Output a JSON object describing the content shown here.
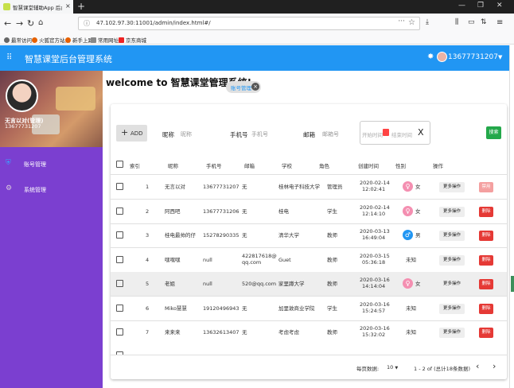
{
  "browser": {
    "tab_title": "智慧课堂辅助App 后台管理系统",
    "url": "47.102.97.30:11001/admin/index.html#/",
    "bookmarks": [
      "最常访问",
      "火狐官方站点",
      "新手上路",
      "常用网址",
      "京东商城"
    ]
  },
  "header": {
    "title": "智慧课堂后台管理系统",
    "user_phone": "13677731207"
  },
  "sidebar": {
    "user_name": "无言以对(管理)",
    "user_phone": "13677731207",
    "items": [
      {
        "label": "账号管理",
        "icon": "shield-icon"
      },
      {
        "label": "系统管理",
        "icon": "gear-icon"
      }
    ]
  },
  "main": {
    "welcome": "welcome to 智慧课堂管理系统!",
    "chip_label": "账号管理"
  },
  "toolbar": {
    "add_label": "ADD",
    "nickname_label": "昵称",
    "nickname_placeholder": "昵称",
    "phone_label": "手机号",
    "phone_placeholder": "手机号",
    "email_label": "邮箱",
    "email_placeholder": "邮箱号",
    "start_time_placeholder": "开始时间",
    "end_time_placeholder": "结束时间",
    "clear_label": "X",
    "search_label": "搜索"
  },
  "table": {
    "headers": [
      "索引",
      "昵称",
      "手机号",
      "邮箱",
      "学校",
      "角色",
      "创建时间",
      "性别",
      "操作"
    ],
    "more_label": "更多操作",
    "disable_label": "禁用",
    "delete_label": "删除",
    "rows": [
      {
        "index": "1",
        "nickname": "无言以对",
        "phone": "13677731207",
        "email": "无",
        "school": "桂林电子科技大学",
        "role": "管理员",
        "date": "2020-02-14",
        "time": "12:02:41",
        "gender": "女",
        "gender_type": "f",
        "action": "禁用"
      },
      {
        "index": "2",
        "nickname": "阿西吧",
        "phone": "13677731206",
        "email": "无",
        "school": "桂电",
        "role": "学生",
        "date": "2020-02-14",
        "time": "12:14:10",
        "gender": "女",
        "gender_type": "f",
        "action": "删除"
      },
      {
        "index": "3",
        "nickname": "桂电最帅的仔",
        "phone": "15278290335",
        "email": "无",
        "school": "清华大学",
        "role": "教师",
        "date": "2020-03-13",
        "time": "16:49:04",
        "gender": "男",
        "gender_type": "m",
        "action": "删除"
      },
      {
        "index": "4",
        "nickname": "嘿嘿嘿",
        "phone": "null",
        "email": "422817618@qq.com",
        "school": "Guet",
        "role": "教师",
        "date": "2020-03-15",
        "time": "05:36:18",
        "gender": "未知",
        "gender_type": "u",
        "action": "删除"
      },
      {
        "index": "5",
        "nickname": "老姐",
        "phone": "null",
        "email": "520@qq.com",
        "school": "家里蹲大学",
        "role": "教师",
        "date": "2020-03-16",
        "time": "14:14:04",
        "gender": "女",
        "gender_type": "f",
        "action": "删除"
      },
      {
        "index": "6",
        "nickname": "Miko慧慧",
        "phone": "19120496943",
        "email": "无",
        "school": "加里敦商业学院",
        "role": "学生",
        "date": "2020-03-16",
        "time": "15:24:57",
        "gender": "未知",
        "gender_type": "u",
        "action": "删除"
      },
      {
        "index": "7",
        "nickname": "来来来",
        "phone": "13632613407",
        "email": "无",
        "school": "考虑考虑",
        "role": "教师",
        "date": "2020-03-16",
        "time": "15:32:02",
        "gender": "未知",
        "gender_type": "u",
        "action": "删除"
      }
    ]
  },
  "pagination": {
    "rows_per_page_label": "每页数据:",
    "rows_per_page": "10",
    "range_text": "1 - 2 of (总计18条数据)"
  }
}
